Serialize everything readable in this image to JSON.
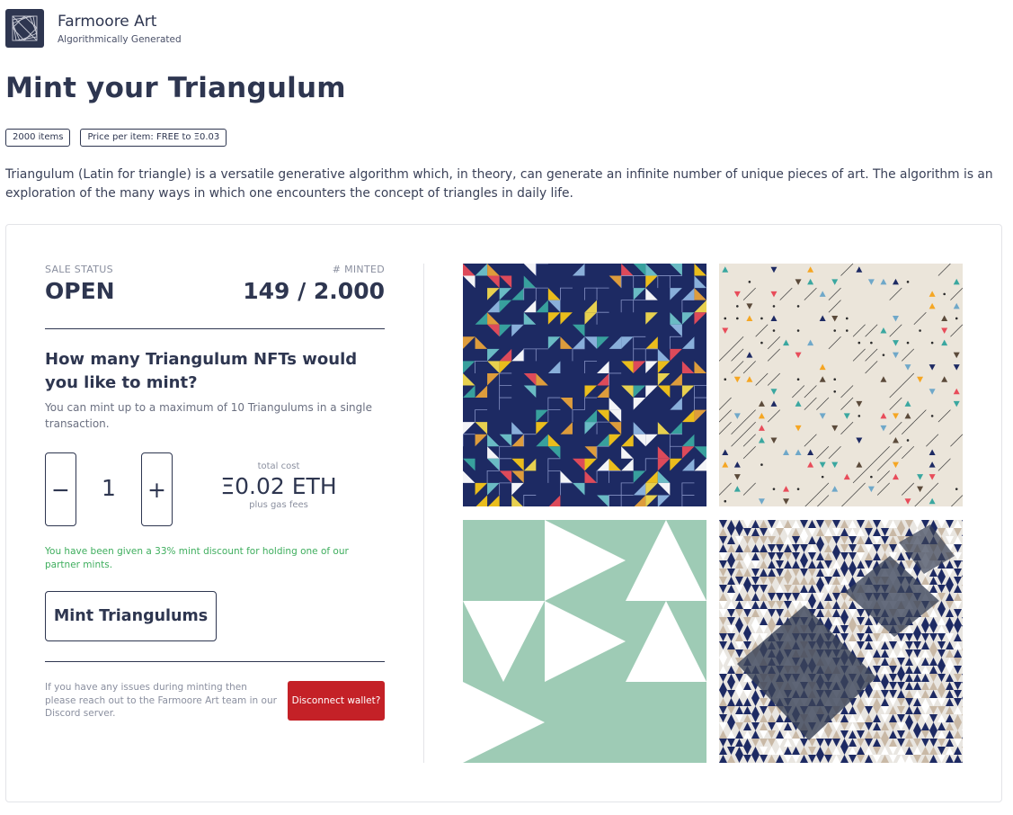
{
  "header": {
    "brand_name": "Farmoore Art",
    "brand_sub": "Algorithmically Generated"
  },
  "page_title": "Mint your Triangulum",
  "badges": {
    "items": "2000 items",
    "price": "Price per item: FREE to Ξ0.03"
  },
  "description": "Triangulum (Latin for triangle) is a versatile generative algorithm which, in theory, can generate an infinite number of unique pieces of art. The algorithm is an exploration of the many ways in which one encounters the concept of triangles in daily life.",
  "mint_panel": {
    "sale_status_label": "SALE STATUS",
    "sale_status": "OPEN",
    "minted_label": "# MINTED",
    "minted": "149 / 2.000",
    "question": "How many Triangulum NFTs would you like to mint?",
    "note": "You can mint up to a maximum of 10 Triangulums in a single transaction.",
    "decrement": "−",
    "quantity": "1",
    "increment": "+",
    "total_cost_label": "total cost",
    "total_cost": "Ξ0.02 ETH",
    "gas_note": "plus gas fees",
    "discount_note": "You have been given a 33% mint discount for holding one of our partner mints.",
    "mint_button": "Mint Triangulums",
    "help_text": "If you have any issues during minting then please reach out to the Farmoore Art team in our Discord server.",
    "disconnect_button": "Disconnect wallet?"
  },
  "colors": {
    "primary": "#2e3650",
    "danger": "#c42127",
    "success": "#3fae5e",
    "art_navy": "#1d2a63",
    "art_cream": "#ebe5da",
    "art_mint": "#9ecbb5"
  }
}
